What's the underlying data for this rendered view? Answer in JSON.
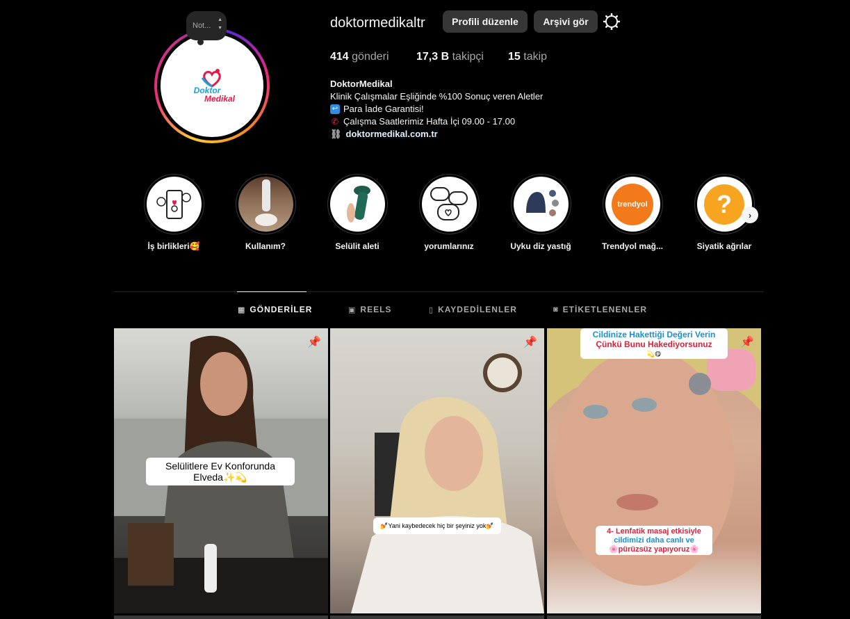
{
  "profile": {
    "username": "doktormedikaltr",
    "note_label": "Not...",
    "edit_button": "Profili düzenle",
    "archive_button": "Arşivi gör",
    "logo_line1": "Doktor",
    "logo_line2": "Medikal",
    "stats": {
      "posts_count": "414",
      "posts_label": "gönderi",
      "followers_count": "17,3 B",
      "followers_label": "takipçi",
      "following_count": "15",
      "following_label": "takip"
    },
    "bio": {
      "name": "DoktorMedikal",
      "line1": "Klinik Çalışmalar Eşliğinde %100 Sonuç veren Aletler",
      "line2": "Para İade Garantisi!",
      "line3": "Çalışma Saatlerimiz Hafta İçi 09.00 - 17.00",
      "link": "doktormedikal.com.tr"
    }
  },
  "highlights": [
    {
      "label": "İş birlikleri🥰",
      "icon": "phone-heart-illustration"
    },
    {
      "label": "Kullanım?",
      "icon": "device-photo"
    },
    {
      "label": "Selülit aleti",
      "icon": "massager-photo"
    },
    {
      "label": "yorumlarınız",
      "icon": "chat-bubbles-illustration"
    },
    {
      "label": "Uyku diz yastığ",
      "icon": "knee-pillow-photo"
    },
    {
      "label": "Trendyol mağ...",
      "icon": "trendyol-logo"
    },
    {
      "label": "Siyatik ağrılar",
      "icon": "question-mark-badge"
    }
  ],
  "trendyol_text": "trendyol",
  "tabs": [
    {
      "label": "GÖNDERİLER",
      "icon": "grid-icon",
      "active": true
    },
    {
      "label": "REELS",
      "icon": "reels-icon",
      "active": false
    },
    {
      "label": "KAYDEDİLENLER",
      "icon": "bookmark-icon",
      "active": false
    },
    {
      "label": "ETİKETLENENLER",
      "icon": "tag-icon",
      "active": false
    }
  ],
  "posts": [
    {
      "caption": "Selülitlere Ev Konforunda Elveda✨💫",
      "pinned": true
    },
    {
      "caption": "💅Yani kaybedecek hiç bir şeyiniz yok💅",
      "pinned": true
    },
    {
      "caption_top_blue": "Cildinize Hakettiği Değeri Verin",
      "caption_top_red": "Çünkü Bunu Hakediyorsunuz",
      "caption_top_emoji": "💫😋",
      "caption_bottom_red": "4- Lenfatik masaj etkisiyle",
      "caption_bottom_blue": "cildimizi daha canlı ve",
      "caption_bottom_red2": "🌸pürüzsüz yapıyoruz🌸",
      "pinned": true
    }
  ],
  "colors": {
    "background": "#000000",
    "button": "#363636",
    "muted_text": "#a8a8a8",
    "brand_blue": "#1aa0dc",
    "brand_red": "#e5194b",
    "trendyol_orange": "#f27a1a"
  }
}
